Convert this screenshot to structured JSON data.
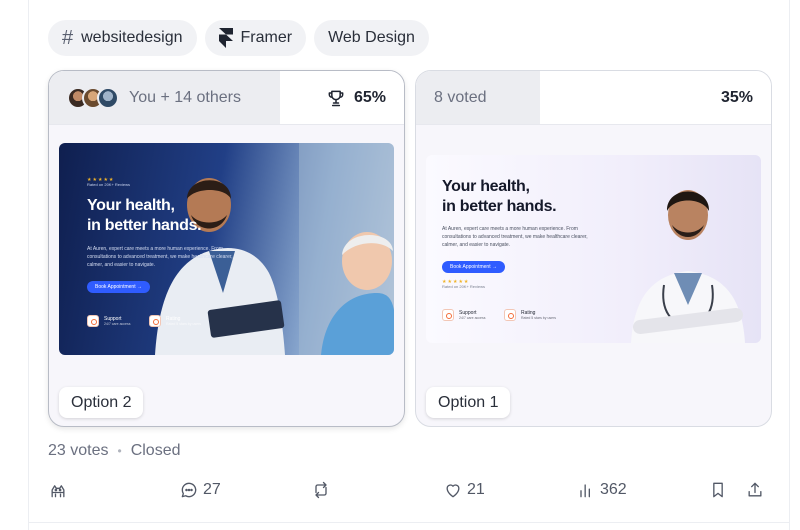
{
  "tags": [
    {
      "label": "websitedesign",
      "icon": "hashtag-icon"
    },
    {
      "label": "Framer",
      "icon": "framer-logo-icon"
    },
    {
      "label": "Web Design",
      "icon": ""
    }
  ],
  "options": [
    {
      "label": "Option 2",
      "voters_text": "You + 14 others",
      "percent": "65%",
      "percent_fraction": 0.65,
      "winner_icon": "trophy-icon",
      "preview": {
        "rating_text": "Rated on 20K+ Reviews",
        "title_line1": "Your health,",
        "title_line2": "in better hands.",
        "body": "At Auren, expert care meets a more human experience. From consultations to advanced treatment, we make healthcare clearer, calmer, and easier to navigate.",
        "cta": "Book Appointment →",
        "feature1_title": "Support",
        "feature1_sub": "24/7 care access",
        "feature2_title": "Rating",
        "feature2_sub": "Rated 5 stars by users"
      }
    },
    {
      "label": "Option 1",
      "voters_text": "8 voted",
      "percent": "35%",
      "percent_fraction": 0.35,
      "preview": {
        "title_line1": "Your health,",
        "title_line2": "in better hands.",
        "body": "At Auren, expert care meets a more human experience. From consultations to advanced treatment, we make healthcare clearer, calmer, and easier to navigate.",
        "cta": "Book Appointment →",
        "rating_text": "Rated on 20K+ Reviews",
        "feature1_title": "Support",
        "feature1_sub": "24/7 care access",
        "feature2_title": "Rating",
        "feature2_sub": "Rated 5 stars by users"
      }
    }
  ],
  "meta": {
    "votes": "23 votes",
    "separator": "•",
    "status": "Closed"
  },
  "actions": {
    "comments": "27",
    "likes": "21",
    "views": "362"
  },
  "colors": {
    "accent_blue": "#2f5cff",
    "poll_fill": "#ecedf1",
    "border": "#d9dce3"
  }
}
